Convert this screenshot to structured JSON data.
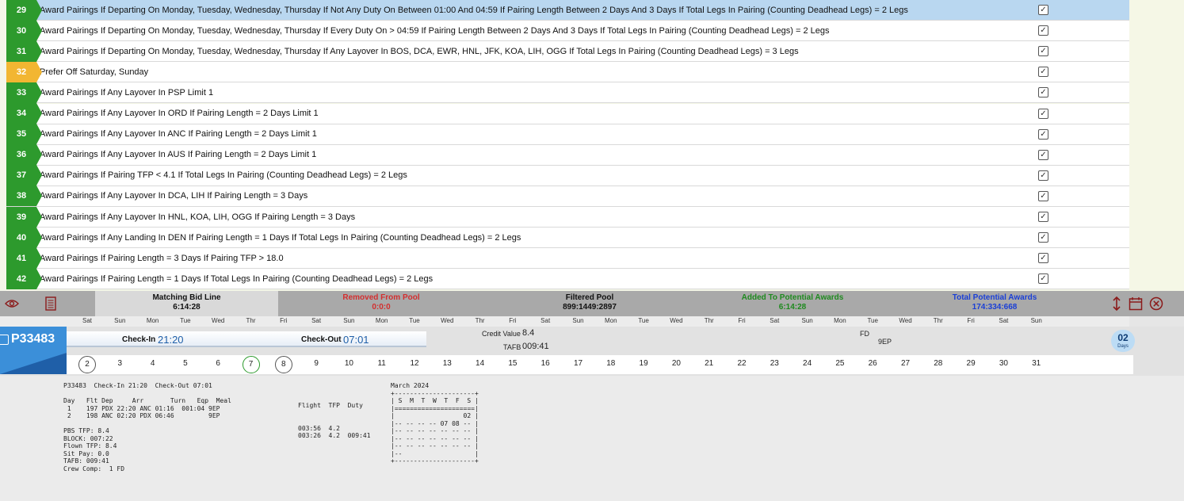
{
  "bid_lines": [
    {
      "num": "29",
      "color": "#2d9a2d",
      "selected": true,
      "checked": true,
      "text": "Award Pairings If Departing On Monday, Tuesday, Wednesday, Thursday If Not Any Duty On Between 01:00 And 04:59 If Pairing Length Between 2 Days And 3 Days If Total Legs In Pairing (Counting Deadhead Legs) = 2 Legs"
    },
    {
      "num": "30",
      "color": "#2d9a2d",
      "selected": false,
      "checked": true,
      "text": "Award Pairings If Departing On Monday, Tuesday, Wednesday, Thursday If Every Duty On > 04:59 If Pairing Length Between 2 Days And 3 Days If Total Legs In Pairing (Counting Deadhead Legs) = 2 Legs"
    },
    {
      "num": "31",
      "color": "#2d9a2d",
      "selected": false,
      "checked": true,
      "text": "Award Pairings If Departing On Monday, Tuesday, Wednesday, Thursday If Any Layover In BOS, DCA, EWR, HNL, JFK, KOA, LIH, OGG If Total Legs In Pairing (Counting Deadhead Legs) = 3 Legs"
    },
    {
      "num": "32",
      "color": "#f2b632",
      "selected": false,
      "checked": true,
      "text": "Prefer Off Saturday, Sunday"
    },
    {
      "num": "33",
      "color": "#2d9a2d",
      "selected": false,
      "checked": true,
      "text": "Award Pairings If Any Layover In PSP Limit 1"
    },
    {
      "num": "34",
      "color": "#2d9a2d",
      "selected": false,
      "checked": true,
      "text": "Award Pairings If Any Layover In ORD If Pairing Length = 2 Days Limit 1"
    },
    {
      "num": "35",
      "color": "#2d9a2d",
      "selected": false,
      "checked": true,
      "text": "Award Pairings If Any Layover In ANC If Pairing Length = 2 Days Limit 1"
    },
    {
      "num": "36",
      "color": "#2d9a2d",
      "selected": false,
      "checked": true,
      "text": "Award Pairings If Any Layover In AUS If Pairing Length = 2 Days Limit 1"
    },
    {
      "num": "37",
      "color": "#2d9a2d",
      "selected": false,
      "checked": true,
      "text": "Award Pairings If Pairing TFP < 4.1 If Total Legs In Pairing (Counting Deadhead Legs) = 2 Legs"
    },
    {
      "num": "38",
      "color": "#2d9a2d",
      "selected": false,
      "checked": true,
      "text": "Award Pairings If Any Layover In DCA, LIH If Pairing Length = 3 Days"
    },
    {
      "num": "39",
      "color": "#2d9a2d",
      "selected": false,
      "checked": true,
      "text": "Award Pairings If Any Layover In HNL, KOA, LIH, OGG If Pairing Length = 3 Days"
    },
    {
      "num": "40",
      "color": "#2d9a2d",
      "selected": false,
      "checked": true,
      "text": "Award Pairings If Any Landing In DEN If Pairing Length = 1 Days If Total Legs In Pairing (Counting Deadhead Legs) = 2 Legs"
    },
    {
      "num": "41",
      "color": "#2d9a2d",
      "selected": false,
      "checked": true,
      "text": "Award Pairings If Pairing Length = 3 Days If Pairing TFP > 18.0"
    },
    {
      "num": "42",
      "color": "#2d9a2d",
      "selected": false,
      "checked": true,
      "text": "Award Pairings If Pairing Length = 1 Days If Total Legs In Pairing (Counting Deadhead Legs) = 2 Legs"
    }
  ],
  "summary": {
    "matching_label": "Matching Bid Line",
    "matching_value": "6:14:28",
    "removed_label": "Removed From Pool",
    "removed_value": "0:0:0",
    "filtered_label": "Filtered Pool",
    "filtered_value": "899:1449:2897",
    "added_label": "Added To Potential Awards",
    "added_value": "6:14:28",
    "total_label": "Total Potential Awards",
    "total_value": "174:334:668",
    "icons": [
      "eye-icon",
      "document-icon",
      "resize-vertical-icon",
      "calendar-icon",
      "close-circle-icon"
    ]
  },
  "day_names": [
    "Sat",
    "Sun",
    "Mon",
    "Tue",
    "Wed",
    "Thr",
    "Fri",
    "Sat",
    "Sun",
    "Mon",
    "Tue",
    "Wed",
    "Thr",
    "Fri",
    "Sat",
    "Sun",
    "Mon",
    "Tue",
    "Wed",
    "Thr",
    "Fri",
    "Sat",
    "Sun",
    "Mon",
    "Tue",
    "Wed",
    "Thr",
    "Fri",
    "Sat",
    "Sun"
  ],
  "pairing": {
    "id": "P33483",
    "checkin_label": "Check-In",
    "checkin_time": "21:20",
    "checkout_label": "Check-Out",
    "checkout_time": "07:01",
    "credit_label": "Credit Value",
    "credit_value": "8.4",
    "tafb_label": "TAFB",
    "tafb_value": "009:41",
    "crew": "FD",
    "equipment": "9EP",
    "days_count": "02",
    "days_unit": "Days",
    "dates": [
      "2",
      "3",
      "4",
      "5",
      "6",
      "7",
      "8",
      "9",
      "10",
      "11",
      "12",
      "13",
      "14",
      "15",
      "16",
      "17",
      "18",
      "19",
      "20",
      "21",
      "22",
      "23",
      "24",
      "25",
      "26",
      "27",
      "28",
      "29",
      "30",
      "31"
    ],
    "circled_dates": [
      "2",
      "7",
      "8"
    ],
    "green_dates": [
      "7"
    ]
  },
  "detail": {
    "left_text": "P33483  Check-In 21:20  Check-Out 07:01\n\nDay   Flt Dep     Arr       Turn   Eqp  Meal\n 1    197 PDX 22:20 ANC 01:16  001:04 9EP\n 2    198 ANC 02:20 PDX 06:46         9EP\n\nPBS TFP: 8.4\nBLOCK: 007:22\nFlown TFP: 8.4\nSit Pay: 0.0\nTAFB: 009:41\nCrew Comp:  1 FD",
    "mid_text": "Flight  TFP  Duty\n\n\n003:56  4.2\n003:26  4.2  009:41",
    "calendar_text": "March 2024\n+---------------------+\n| S  M  T  W  T  F  S |\n|=====================|\n|                  02 |\n|-- -- -- -- 07 08 -- |\n|-- -- -- -- -- -- -- |\n|-- -- -- -- -- -- -- |\n|-- -- -- -- -- -- -- |\n|--                   |\n+---------------------+"
  }
}
